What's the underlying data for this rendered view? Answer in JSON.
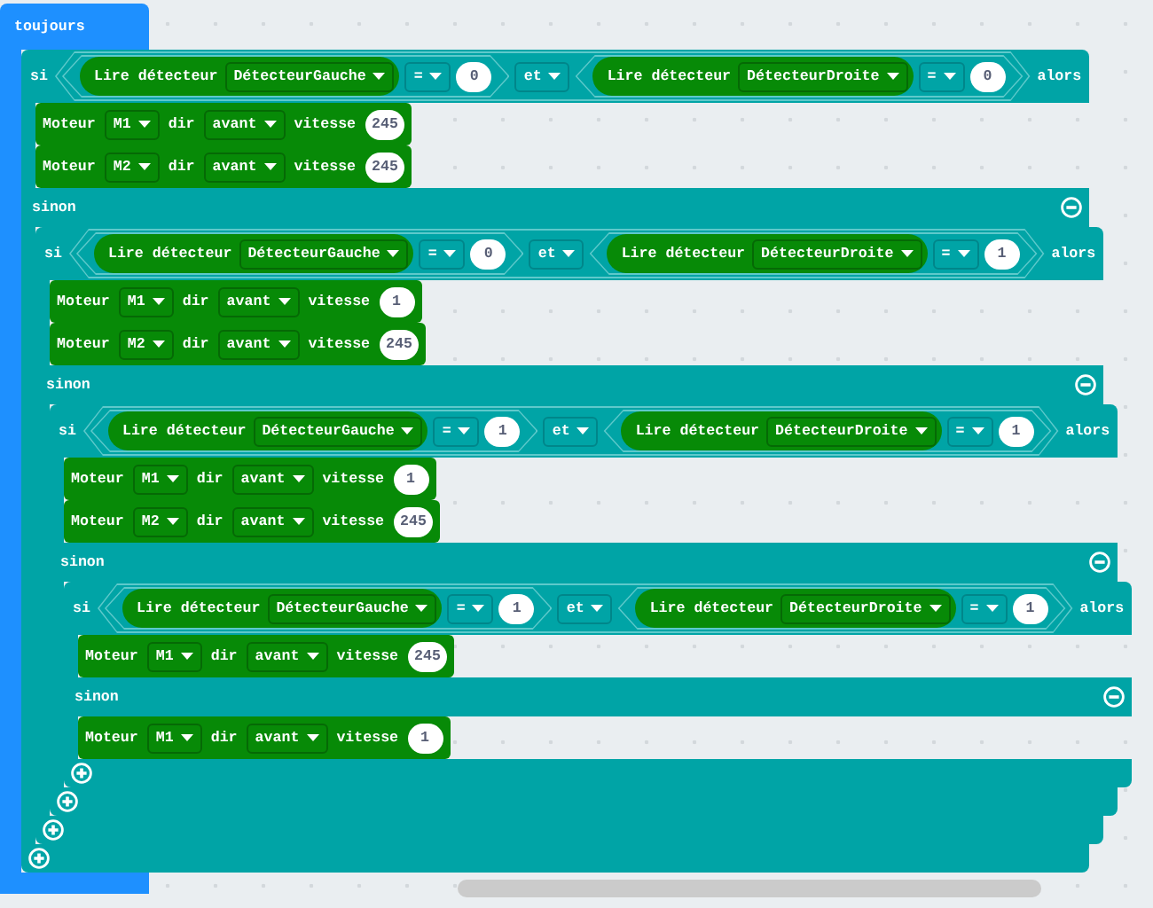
{
  "forever": {
    "label": "toujours",
    "body": [
      {
        "kind": "if",
        "if_label": "si",
        "condition": {
          "left": {
            "sensor_label": "Lire détecteur",
            "sensor": "DétecteurGauche",
            "operator": "=",
            "value": "0"
          },
          "and_label": "et",
          "right": {
            "sensor_label": "Lire détecteur",
            "sensor": "DétecteurDroite",
            "operator": "=",
            "value": "0"
          }
        },
        "then_label": "alors",
        "then": [
          {
            "kind": "motor",
            "label": "Moteur",
            "motor": "M1",
            "dir_label": "dir",
            "direction": "avant",
            "speed_label": "vitesse",
            "speed": "245"
          },
          {
            "kind": "motor",
            "label": "Moteur",
            "motor": "M2",
            "dir_label": "dir",
            "direction": "avant",
            "speed_label": "vitesse",
            "speed": "245"
          }
        ],
        "else_label": "sinon",
        "else": [
          {
            "kind": "if",
            "if_label": "si",
            "condition": {
              "left": {
                "sensor_label": "Lire détecteur",
                "sensor": "DétecteurGauche",
                "operator": "=",
                "value": "0"
              },
              "and_label": "et",
              "right": {
                "sensor_label": "Lire détecteur",
                "sensor": "DétecteurDroite",
                "operator": "=",
                "value": "1"
              }
            },
            "then_label": "alors",
            "then": [
              {
                "kind": "motor",
                "label": "Moteur",
                "motor": "M1",
                "dir_label": "dir",
                "direction": "avant",
                "speed_label": "vitesse",
                "speed": "1"
              },
              {
                "kind": "motor",
                "label": "Moteur",
                "motor": "M2",
                "dir_label": "dir",
                "direction": "avant",
                "speed_label": "vitesse",
                "speed": "245"
              }
            ],
            "else_label": "sinon",
            "else": [
              {
                "kind": "if",
                "if_label": "si",
                "condition": {
                  "left": {
                    "sensor_label": "Lire détecteur",
                    "sensor": "DétecteurGauche",
                    "operator": "=",
                    "value": "1"
                  },
                  "and_label": "et",
                  "right": {
                    "sensor_label": "Lire détecteur",
                    "sensor": "DétecteurDroite",
                    "operator": "=",
                    "value": "1"
                  }
                },
                "then_label": "alors",
                "then": [
                  {
                    "kind": "motor",
                    "label": "Moteur",
                    "motor": "M1",
                    "dir_label": "dir",
                    "direction": "avant",
                    "speed_label": "vitesse",
                    "speed": "1"
                  },
                  {
                    "kind": "motor",
                    "label": "Moteur",
                    "motor": "M2",
                    "dir_label": "dir",
                    "direction": "avant",
                    "speed_label": "vitesse",
                    "speed": "245"
                  }
                ],
                "else_label": "sinon",
                "else": [
                  {
                    "kind": "if",
                    "if_label": "si",
                    "condition": {
                      "left": {
                        "sensor_label": "Lire détecteur",
                        "sensor": "DétecteurGauche",
                        "operator": "=",
                        "value": "1"
                      },
                      "and_label": "et",
                      "right": {
                        "sensor_label": "Lire détecteur",
                        "sensor": "DétecteurDroite",
                        "operator": "=",
                        "value": "1"
                      }
                    },
                    "then_label": "alors",
                    "then": [
                      {
                        "kind": "motor",
                        "label": "Moteur",
                        "motor": "M1",
                        "dir_label": "dir",
                        "direction": "avant",
                        "speed_label": "vitesse",
                        "speed": "245"
                      }
                    ],
                    "else_label": "sinon",
                    "else": [
                      {
                        "kind": "motor",
                        "label": "Moteur",
                        "motor": "M1",
                        "dir_label": "dir",
                        "direction": "avant",
                        "speed_label": "vitesse",
                        "speed": "1"
                      }
                    ]
                  }
                ]
              }
            ]
          }
        ]
      }
    ]
  }
}
